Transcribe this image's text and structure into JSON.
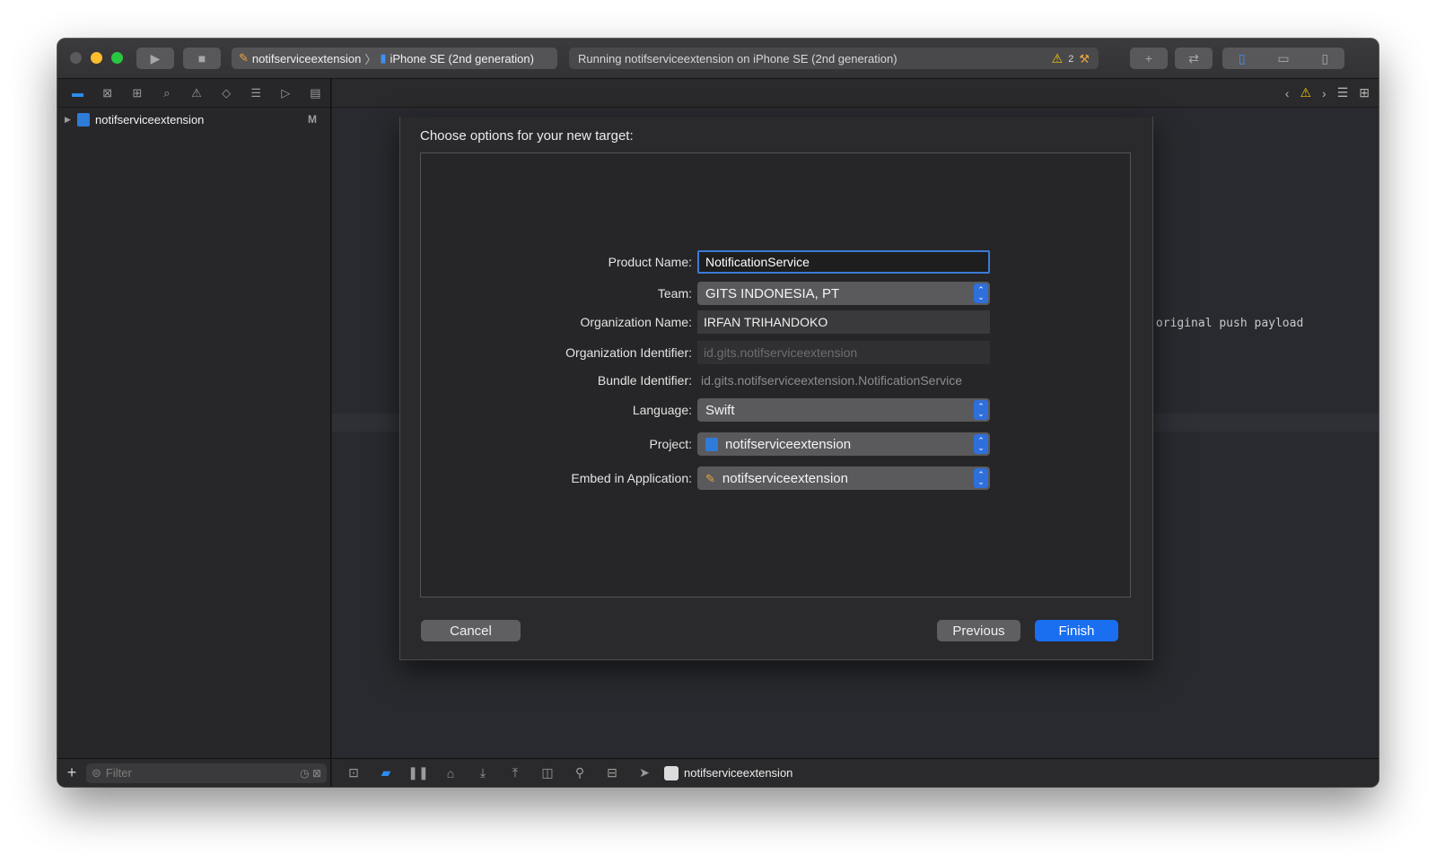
{
  "toolbar": {
    "scheme_name": "notifserviceextension",
    "device_name": "iPhone SE (2nd generation)",
    "status_text": "Running notifserviceextension on iPhone SE (2nd generation)",
    "warning_count": "2"
  },
  "navigator": {
    "project_name": "notifserviceextension",
    "project_badge": "M",
    "filter_placeholder": "Filter"
  },
  "editor": {
    "code_lines": [
      "herwise the original push payload",
      "{"
    ]
  },
  "sheet": {
    "title": "Choose options for your new target:",
    "fields": {
      "product_name": {
        "label": "Product Name:",
        "value": "NotificationService"
      },
      "team": {
        "label": "Team:",
        "value": "GITS INDONESIA, PT"
      },
      "organization_name": {
        "label": "Organization Name:",
        "value": "IRFAN TRIHANDOKO"
      },
      "organization_identifier": {
        "label": "Organization Identifier:",
        "value": "id.gits.notifserviceextension"
      },
      "bundle_identifier": {
        "label": "Bundle Identifier:",
        "value": "id.gits.notifserviceextension.NotificationService"
      },
      "language": {
        "label": "Language:",
        "value": "Swift"
      },
      "project": {
        "label": "Project:",
        "value": "notifserviceextension"
      },
      "embed_in_application": {
        "label": "Embed in Application:",
        "value": "notifserviceextension"
      }
    },
    "buttons": {
      "cancel": "Cancel",
      "previous": "Previous",
      "finish": "Finish"
    }
  },
  "debug_bar": {
    "target_name": "notifserviceextension"
  },
  "colors": {
    "accent": "#1a6ef0",
    "window_bg": "#1e1e1e",
    "sheet_bg": "#2a2a2c"
  }
}
